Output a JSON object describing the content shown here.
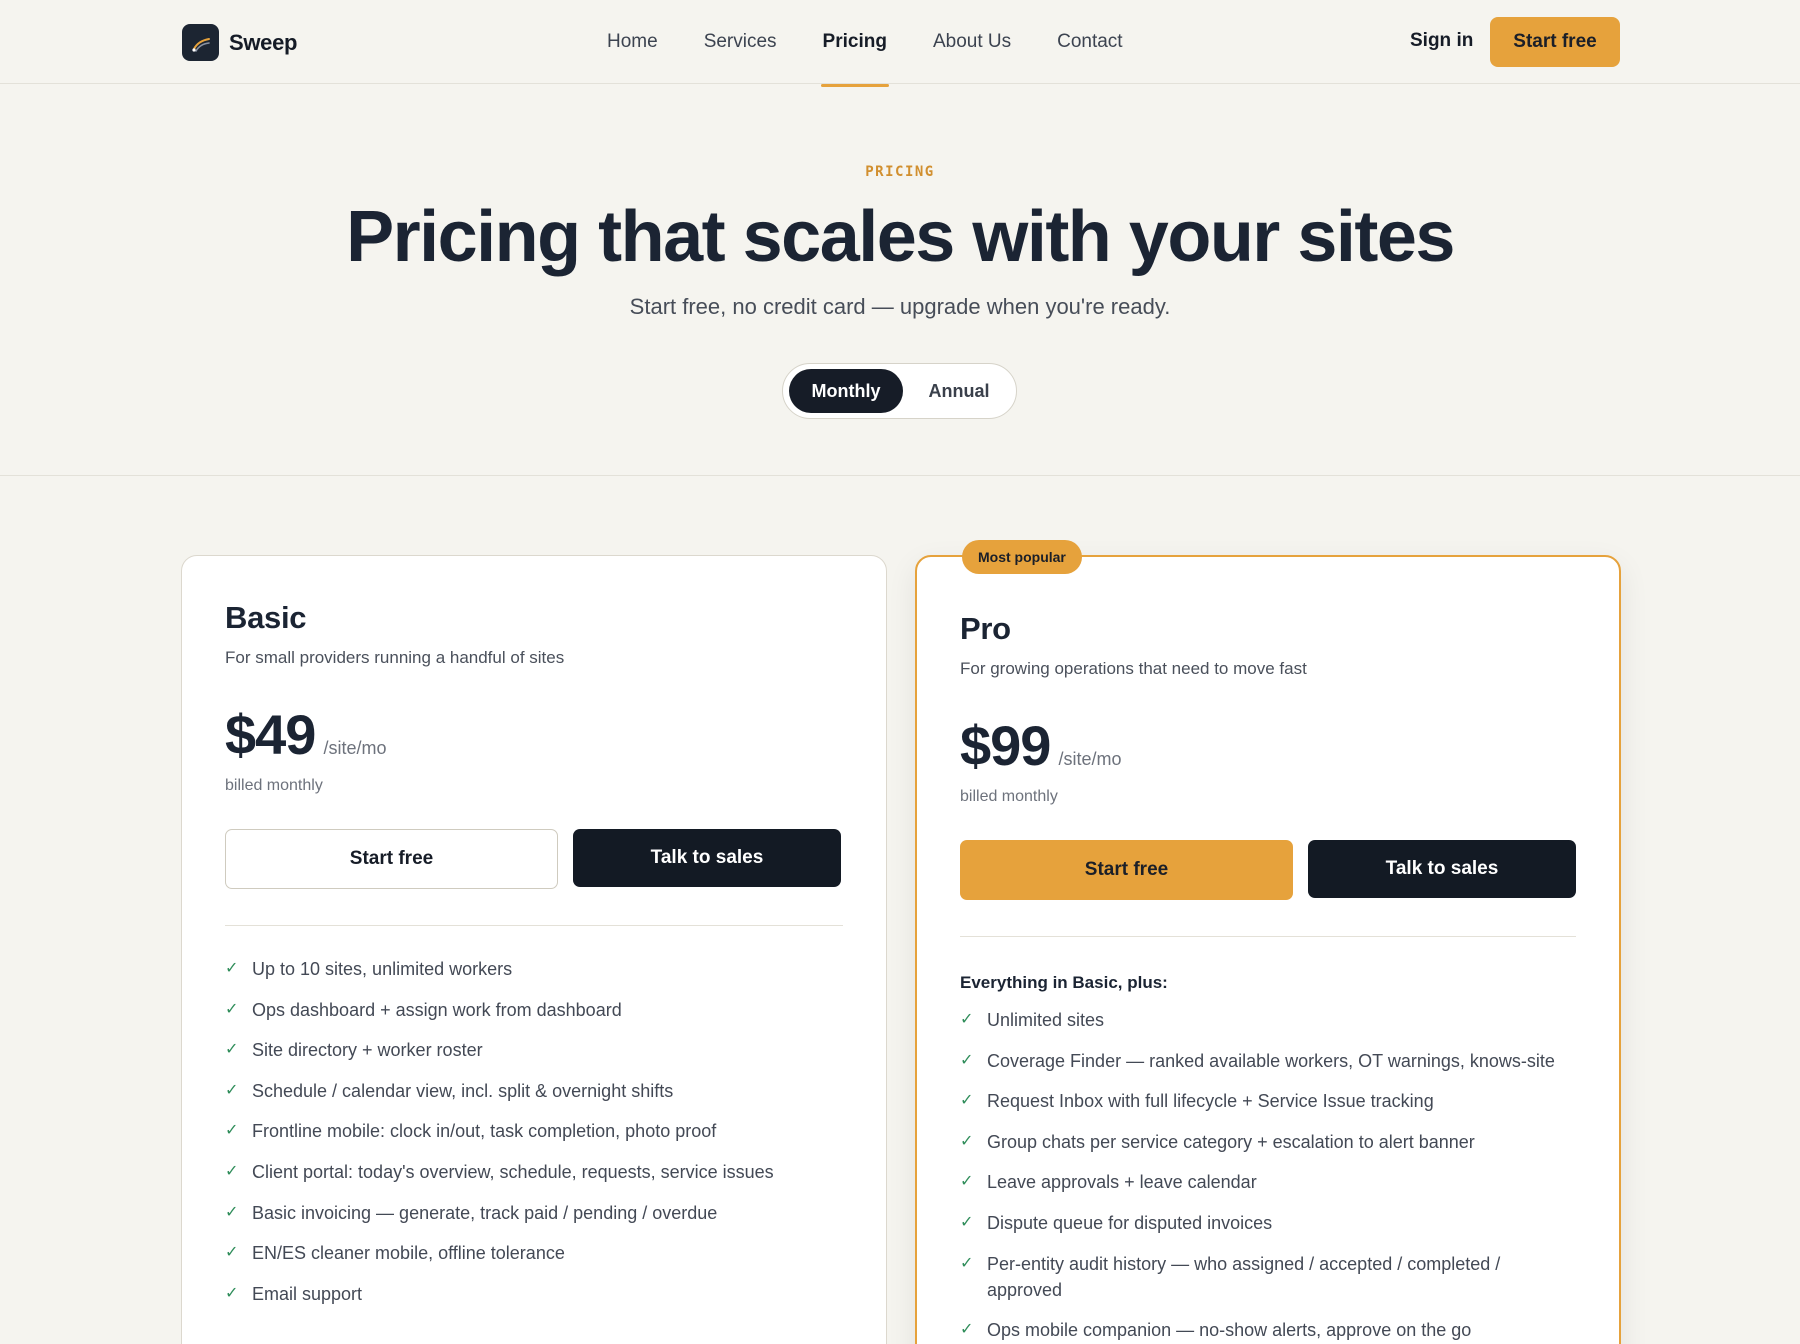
{
  "brand": {
    "name": "Sweep"
  },
  "nav": {
    "items": [
      {
        "label": "Home",
        "active": false
      },
      {
        "label": "Services",
        "active": false
      },
      {
        "label": "Pricing",
        "active": true
      },
      {
        "label": "About Us",
        "active": false
      },
      {
        "label": "Contact",
        "active": false
      }
    ],
    "signin_label": "Sign in",
    "cta_label": "Start free"
  },
  "hero": {
    "eyebrow": "PRICING",
    "title": "Pricing that scales with your sites",
    "subtitle": "Start free, no credit card — upgrade when you're ready.",
    "toggle": {
      "options": [
        "Monthly",
        "Annual"
      ],
      "selected": "Monthly"
    }
  },
  "plans": {
    "basic": {
      "name": "Basic",
      "description": "For small providers running a handful of sites",
      "price": "$49",
      "per": "/site/mo",
      "billed": "billed monthly",
      "primary_label": "Start free",
      "secondary_label": "Talk to sales",
      "features": [
        "Up to 10 sites, unlimited workers",
        "Ops dashboard + assign work from dashboard",
        "Site directory + worker roster",
        "Schedule / calendar view, incl. split & overnight shifts",
        "Frontline mobile: clock in/out, task completion, photo proof",
        "Client portal: today's overview, schedule, requests, service issues",
        "Basic invoicing — generate, track paid / pending / overdue",
        "EN/ES cleaner mobile, offline tolerance",
        "Email support"
      ]
    },
    "pro": {
      "badge": "Most popular",
      "name": "Pro",
      "description": "For growing operations that need to move fast",
      "price": "$99",
      "per": "/site/mo",
      "billed": "billed monthly",
      "primary_label": "Start free",
      "secondary_label": "Talk to sales",
      "features_heading": "Everything in Basic, plus:",
      "features": [
        "Unlimited sites",
        "Coverage Finder — ranked available workers, OT warnings, knows-site",
        "Request Inbox with full lifecycle + Service Issue tracking",
        "Group chats per service category + escalation to alert banner",
        "Leave approvals + leave calendar",
        "Dispute queue for disputed invoices",
        "Per-entity audit history — who assigned / accepted / completed / approved",
        "Ops mobile companion — no-show alerts, approve on the go"
      ]
    }
  },
  "colors": {
    "accent": "#e6a23c",
    "dark": "#131a24",
    "check": "#2f8d5a",
    "background": "#f5f4ef"
  }
}
